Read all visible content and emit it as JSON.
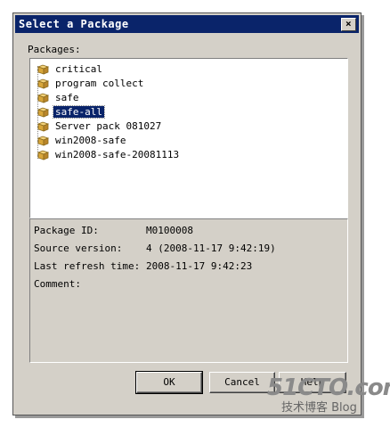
{
  "window": {
    "title": "Select a Package",
    "close_glyph": "×"
  },
  "packages_label": "Packages:",
  "packages": [
    {
      "label": "critical",
      "selected": false
    },
    {
      "label": "program collect",
      "selected": false
    },
    {
      "label": "safe",
      "selected": false
    },
    {
      "label": "safe-all",
      "selected": true
    },
    {
      "label": "Server pack 081027",
      "selected": false
    },
    {
      "label": "win2008-safe",
      "selected": false
    },
    {
      "label": "win2008-safe-20081113",
      "selected": false
    }
  ],
  "details": {
    "package_id_label": "Package ID:",
    "package_id_value": "M0100008",
    "source_version_label": "Source version:",
    "source_version_value": "4 (2008-11-17 9:42:19)",
    "last_refresh_label": "Last refresh time:",
    "last_refresh_value": "2008-11-17 9:42:23",
    "comment_label": "Comment:"
  },
  "buttons": {
    "ok": "OK",
    "cancel": "Cancel",
    "help": "Help"
  },
  "watermark": {
    "line1": "51CTO.com",
    "line2": "技术博客 Blog"
  },
  "colors": {
    "titlebar": "#0a246a",
    "dialog_bg": "#d4d0c8",
    "selection": "#0a246a"
  }
}
